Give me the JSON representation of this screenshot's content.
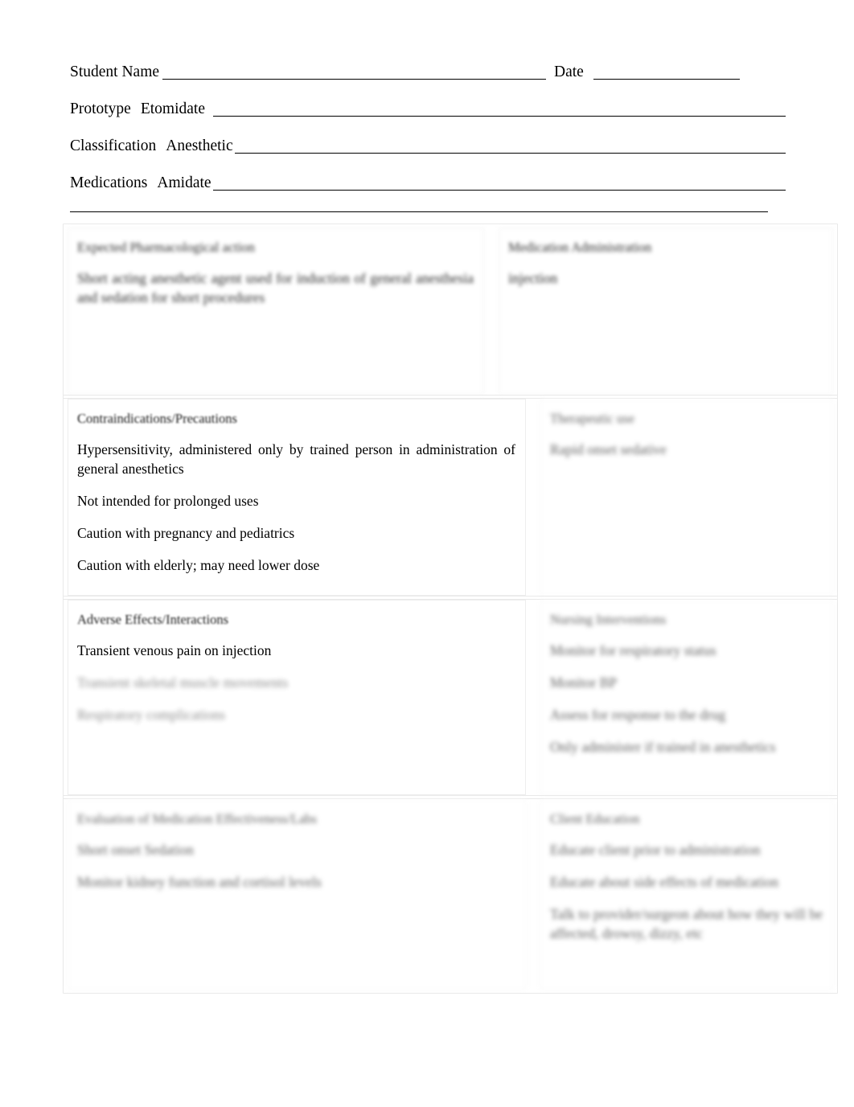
{
  "header": {
    "student_name_label": "Student Name",
    "date_label": "Date",
    "prototype_label": "Prototype",
    "prototype_value": "Etomidate",
    "classification_label": "Classification",
    "classification_value": "Anesthetic",
    "medications_label": "Medications",
    "medications_value": "Amidate"
  },
  "cells": {
    "expected_action": {
      "title": "Expected Pharmacological action",
      "body": [
        "Short acting anesthetic agent used for induction of general anesthesia and sedation for short procedures"
      ]
    },
    "medication_administration": {
      "title": "Medication Administration",
      "body": [
        "injection"
      ]
    },
    "contraindications": {
      "title": "Contraindications/Precautions",
      "body": [
        "Hypersensitivity, administered only by trained person in administration of general anesthetics",
        "Not intended for prolonged uses",
        "Caution with pregnancy and pediatrics",
        "Caution with elderly; may need lower dose"
      ]
    },
    "therapeutic_use": {
      "title": "Therapeutic use",
      "body": [
        "Rapid onset sedative"
      ]
    },
    "adverse_effects": {
      "title": "Adverse Effects/Interactions",
      "body": [
        "Transient venous pain on injection",
        "Transient skeletal muscle movements",
        "Respiratory complications"
      ]
    },
    "nursing_interventions": {
      "title": "Nursing Interventions",
      "body": [
        "Monitor for respiratory status",
        "Monitor BP",
        "Assess for response to the drug",
        "Only administer if trained in anesthetics"
      ]
    },
    "evaluation": {
      "title": "Evaluation of Medication Effectiveness/Labs",
      "body": [
        "Short onset Sedation",
        "Monitor kidney function and cortisol levels"
      ]
    },
    "client_education": {
      "title": "Client Education",
      "body": [
        "Educate client prior to administration",
        "Educate about side effects of medication",
        "Talk to provider/surgeon about how they will be affected, drowsy, dizzy, etc"
      ]
    }
  }
}
